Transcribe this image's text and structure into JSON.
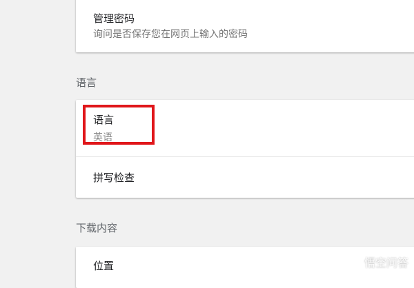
{
  "autofill_card": {
    "manage_passwords": {
      "title": "管理密码",
      "subtitle": "询问是否保存您在网页上输入的密码"
    }
  },
  "language_section": {
    "header": "语言",
    "language_row": {
      "title": "语言",
      "value": "英语"
    },
    "spellcheck_row": {
      "title": "拼写检查"
    }
  },
  "downloads_section": {
    "header": "下载内容",
    "location_row": {
      "title": "位置"
    }
  },
  "annotation": {
    "highlight_color": "#e0161a"
  },
  "watermark": {
    "text": "悟空问答",
    "icon": "chat-bubble-icon"
  }
}
